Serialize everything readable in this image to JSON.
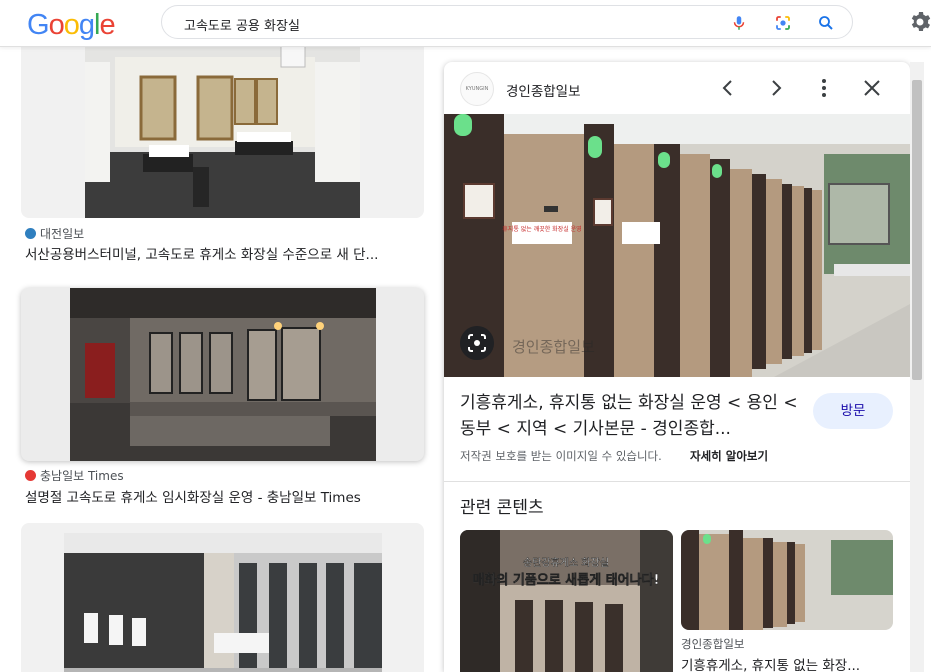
{
  "header": {
    "logo_letters": [
      "G",
      "o",
      "o",
      "g",
      "l",
      "e"
    ],
    "logo_colors": [
      "#4285F4",
      "#EA4335",
      "#FBBC05",
      "#4285F4",
      "#34A853",
      "#EA4335"
    ],
    "query": "고속도로 공용 화장실"
  },
  "results": [
    {
      "source": "대전일보",
      "title": "서산공용버스터미널, 고속도로 휴게소 화장실 수준으로 새 단..."
    },
    {
      "source": "충남일보 Times",
      "title": "설명절 고속도로 휴게소 임시화장실 운영 - 충남일보 Times"
    },
    {
      "source": "",
      "title": ""
    }
  ],
  "panel": {
    "publisher": "경인종합일보",
    "publisher_logo_text": "KYUNGIN",
    "image_watermark": "경인종합일보",
    "image_sign_text": "휴지통 없는 깨끗한 화장실 운영",
    "title": "기흥휴게소, 휴지통 없는 화장실 운영 < 용인 < 동부 < 지역 < 기사본문 - 경인종합...",
    "visit_label": "방문",
    "copyright": "저작권 보호를 받는 이미지일 수 있습니다.",
    "learn_more": "자세히 알아보기",
    "related_heading": "관련 콘텐츠",
    "related": [
      {
        "overlay_top": "송탄강휴게소 화장실",
        "overlay_main": "매화의 기품으로 새롭게 태어나다!"
      },
      {
        "source": "경인종합일보",
        "title": "기흥휴게소, 휴지통 없는 화장..."
      }
    ]
  },
  "colors": {
    "accent_blue": "#1a73e8",
    "visit_bg": "#e8f0fe"
  }
}
